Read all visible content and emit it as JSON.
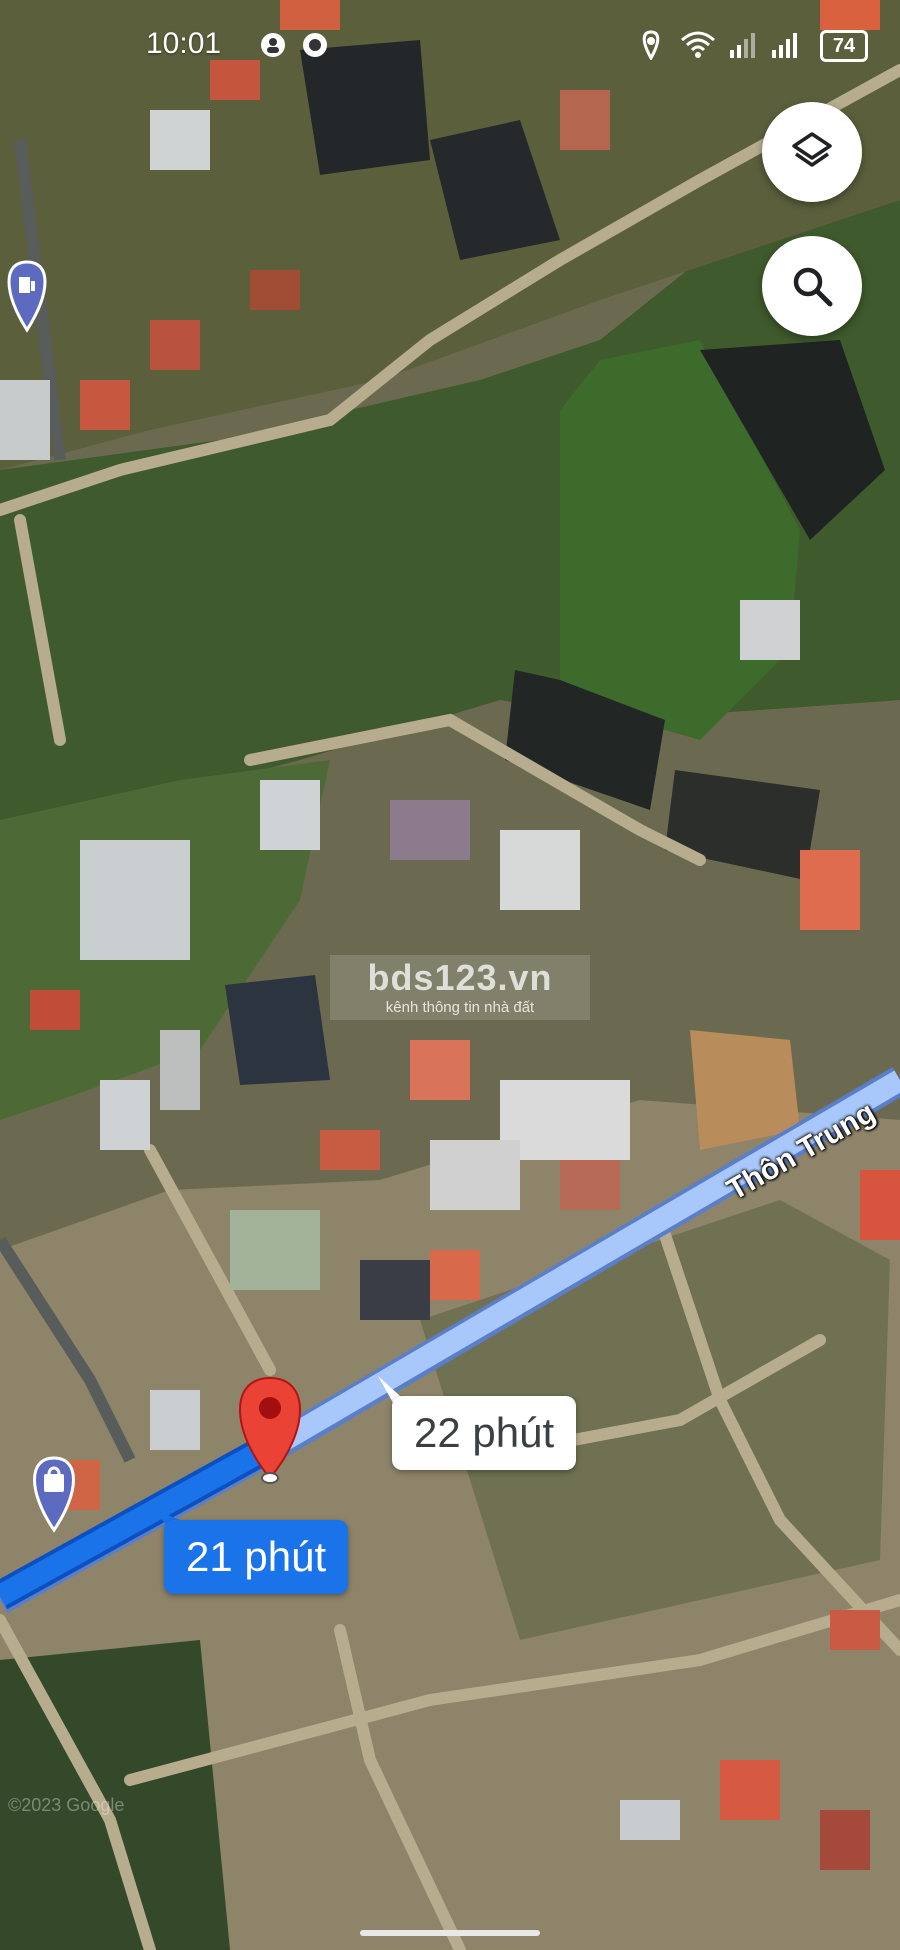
{
  "status_bar": {
    "time": "10:01",
    "battery": "74",
    "icons": [
      "location-icon",
      "wifi-icon",
      "signal-icon",
      "signal-icon"
    ]
  },
  "map": {
    "road_label": "Thôn Trung",
    "route_times": {
      "alternative": "22 phút",
      "selected": "21 phút"
    },
    "markers": [
      "fuel-station-pin",
      "destination-pin",
      "shopping-pin"
    ],
    "watermark": {
      "title": "bds123.vn",
      "subtitle": "kênh thông tin nhà đất"
    },
    "attribution": "©2023 Google"
  },
  "controls": {
    "layers_button": "layers-icon",
    "search_button": "search-icon"
  },
  "colors": {
    "route_blue": "#1a73e8",
    "route_light": "#8ab4f8",
    "pin_red": "#ea4335",
    "pin_purple": "#5c6bc0"
  }
}
